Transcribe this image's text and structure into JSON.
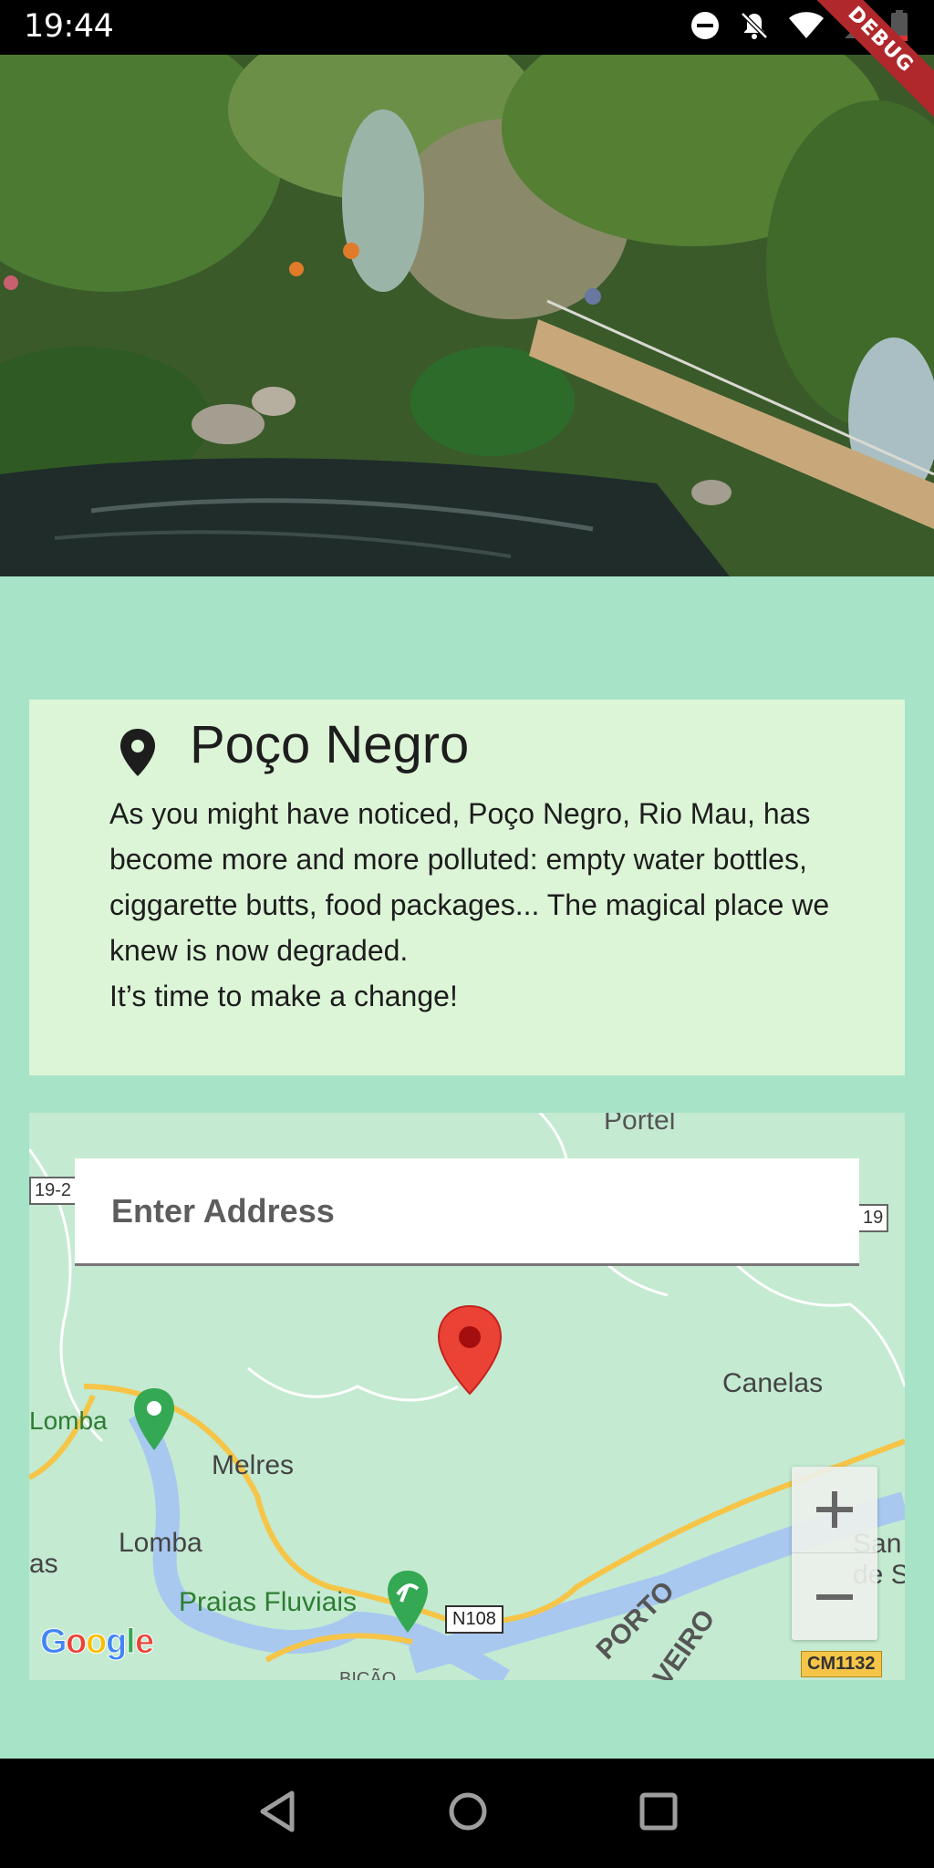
{
  "status_bar": {
    "time": "19:44",
    "icons": [
      "do-not-disturb-icon",
      "notifications-off-icon",
      "wifi-icon",
      "signal-icon",
      "battery-icon"
    ],
    "debug_banner": "DEBUG"
  },
  "hero": {
    "image_subject": "river-pool-with-wooden-boardwalk"
  },
  "place": {
    "icon": "location-pin-icon",
    "name": "Poço Negro",
    "description_line1": "As you might have noticed, Poço Negro, Rio Mau, has become more and more polluted: empty water bottles, ciggarette butts, food packages... The magical place we knew is now degraded.",
    "description_line2": "It’s time to make a change!"
  },
  "map": {
    "search_placeholder": "Enter Address",
    "zoom_in": "+",
    "zoom_out": "−",
    "attribution": "Google",
    "labels": {
      "porte": "Portel",
      "road_19_2": "19-2",
      "road_19": "19",
      "canelas": "Canelas",
      "lomba_top": "Lomba",
      "melres": "Melres",
      "lomba_bottom": "Lomba",
      "as": "as",
      "praias": "Praias Fluviais",
      "n108": "N108",
      "porto": "PORTO",
      "aveiro": "VEIRO",
      "san": "San",
      "de_s": "de S",
      "cm1132": "CM1132",
      "bicao": "BIÇÃO"
    },
    "colors": {
      "land": "#c4ead1",
      "river": "#a8c8f0",
      "road": "#f6c548",
      "marker": "#ea4335",
      "poi": "#34a853"
    }
  },
  "nav": {
    "back": "back-icon",
    "home": "home-icon",
    "recents": "recents-icon"
  }
}
